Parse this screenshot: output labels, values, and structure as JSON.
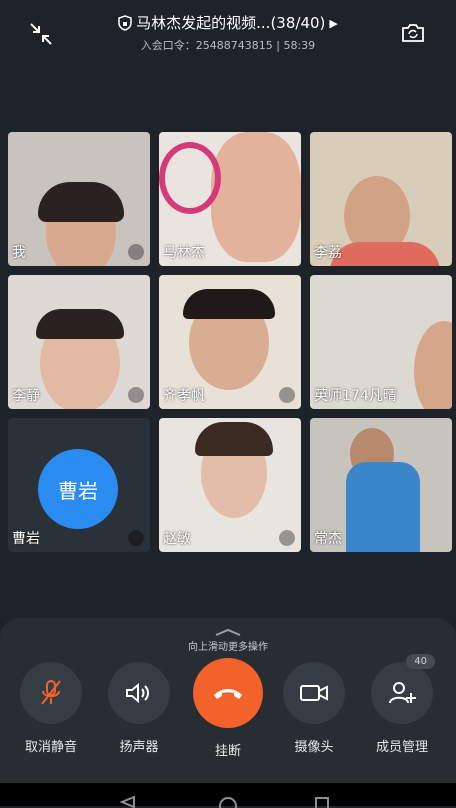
{
  "header": {
    "title": "马林杰发起的视频...(38/40)",
    "subtitle": "入会口令：25488743815 | 58:39"
  },
  "participants": [
    {
      "name": "我",
      "bg": "#c9c3c0",
      "face": "#d9a98f"
    },
    {
      "name": "马林杰",
      "bg": "#e9e4df",
      "face": "#e3b29b"
    },
    {
      "name": "李荔",
      "bg": "#d8cdb8",
      "face": "#d2a285"
    },
    {
      "name": "李静",
      "bg": "#ded9d4",
      "face": "#e2b9a3"
    },
    {
      "name": "齐孝帆",
      "bg": "#e7e1d8",
      "face": "#d8ad91"
    },
    {
      "name": "英师174凡晴",
      "bg": "#dcd8d2",
      "face": "#d6a68a"
    },
    {
      "name": "曹岩",
      "avatar_text": "曹岩"
    },
    {
      "name": "赵敏",
      "bg": "#e8e5e1",
      "face": "#e3bda9"
    },
    {
      "name": "常杰",
      "bg": "#c7c4be",
      "face": "#b78a6d"
    }
  ],
  "panel": {
    "hint": "向上滑动更多操作",
    "controls": [
      {
        "label": "取消静音",
        "icon": "mic-off-icon"
      },
      {
        "label": "扬声器",
        "icon": "speaker-icon"
      },
      {
        "label": "挂断",
        "icon": "hangup-icon"
      },
      {
        "label": "摄像头",
        "icon": "camera-icon"
      },
      {
        "label": "成员管理",
        "icon": "add-member-icon",
        "badge": "40"
      }
    ]
  },
  "colors": {
    "accent": "#f4622c",
    "avatar": "#2a8cf0"
  }
}
